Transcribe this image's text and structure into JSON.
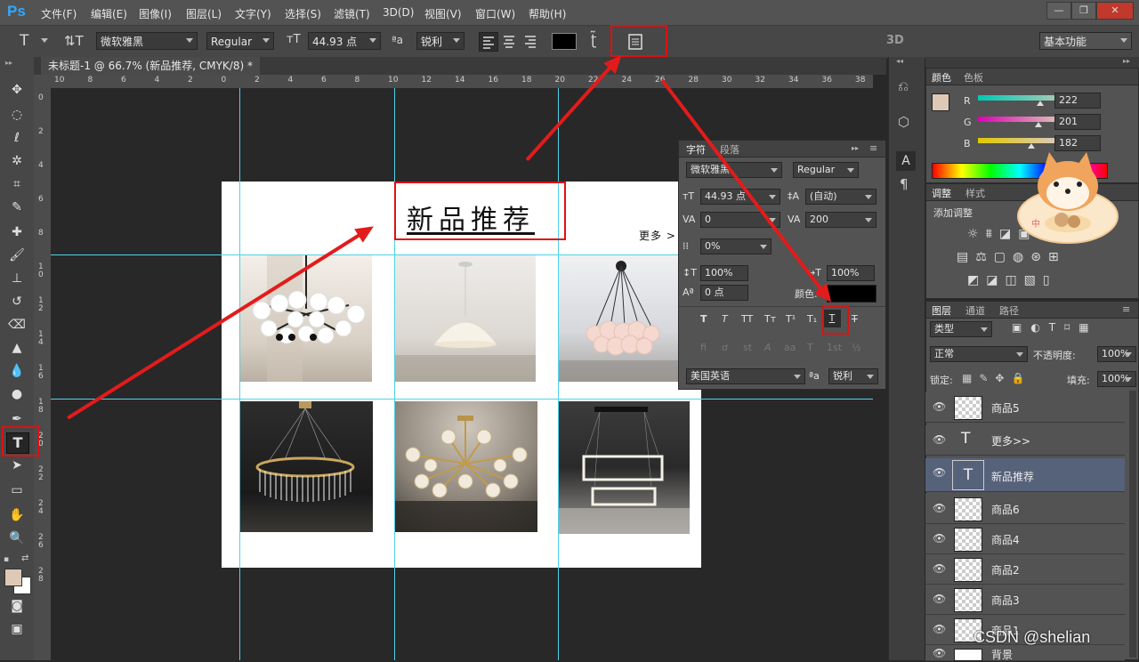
{
  "app": {
    "name": "Ps"
  },
  "menu": [
    "文件(F)",
    "编辑(E)",
    "图像(I)",
    "图层(L)",
    "文字(Y)",
    "选择(S)",
    "滤镜(T)",
    "3D(D)",
    "视图(V)",
    "窗口(W)",
    "帮助(H)"
  ],
  "window_controls": {
    "minimize": "—",
    "restore": "❐",
    "close": "✕"
  },
  "options": {
    "font_family": "微软雅黑",
    "font_style": "Regular",
    "font_size": "44.93 点",
    "aa_label": "ªa",
    "aa_mode": "锐利",
    "mode_3d": "3D",
    "workspace": "基本功能",
    "text_color": "#000000"
  },
  "document": {
    "tab_title": "未标题-1 @ 66.7% (新品推荐, CMYK/8) *"
  },
  "ruler": {
    "h": [
      "10",
      "8",
      "6",
      "4",
      "2",
      "0",
      "2",
      "4",
      "6",
      "8",
      "10",
      "12",
      "14",
      "16",
      "18",
      "20",
      "22",
      "24",
      "26",
      "28",
      "30",
      "32",
      "34",
      "36",
      "38"
    ],
    "v": [
      "0",
      "2",
      "4",
      "6",
      "8",
      "1 0",
      "1 2",
      "1 4",
      "1 6",
      "1 8",
      "2 0",
      "2 2",
      "2 4",
      "2 6",
      "2 8"
    ]
  },
  "canvas": {
    "title": "新品推荐",
    "more": "更多 >"
  },
  "character_panel": {
    "tab_character": "字符",
    "tab_paragraph": "段落",
    "font_family": "微软雅黑",
    "font_style": "Regular",
    "size": "44.93 点",
    "leading": "(自动)",
    "kerning": "0",
    "tracking": "200",
    "tsume": "0%",
    "v_scale": "100%",
    "h_scale": "100%",
    "baseline": "0 点",
    "color_label": "颜色:",
    "language": "美国英语",
    "aa_mode": "锐利",
    "style_buttons": [
      "T",
      "T",
      "TT",
      "Tт",
      "T¹",
      "T₁",
      "T",
      "T"
    ],
    "opentype_buttons": [
      "fi",
      "ơ",
      "st",
      "A",
      "aa",
      "T",
      "1st",
      "½"
    ]
  },
  "color_panel": {
    "tab_color": "颜色",
    "tab_swatches": "色板",
    "r_label": "R",
    "g_label": "G",
    "b_label": "B",
    "r": "222",
    "g": "201",
    "b": "182",
    "foreground": "#dec9b6"
  },
  "adjust_panel": {
    "tab_adjust": "调整",
    "tab_styles": "样式",
    "add_label": "添加调整"
  },
  "layers_panel": {
    "tabs": [
      "图层",
      "通道",
      "路径"
    ],
    "filter_kind": "类型",
    "blend_mode": "正常",
    "opacity_label": "不透明度:",
    "opacity": "100%",
    "lock_label": "锁定:",
    "fill_label": "填充:",
    "fill": "100%",
    "layers": [
      {
        "name": "商品5",
        "type": "image"
      },
      {
        "name": "更多>>",
        "type": "text"
      },
      {
        "name": "新品推荐",
        "type": "text",
        "selected": true
      },
      {
        "name": "商品6",
        "type": "image"
      },
      {
        "name": "商品4",
        "type": "image"
      },
      {
        "name": "商品2",
        "type": "image"
      },
      {
        "name": "商品3",
        "type": "image"
      },
      {
        "name": "商品1",
        "type": "image"
      },
      {
        "name": "背景",
        "type": "background"
      }
    ]
  },
  "watermark": "CSDN @shelian"
}
